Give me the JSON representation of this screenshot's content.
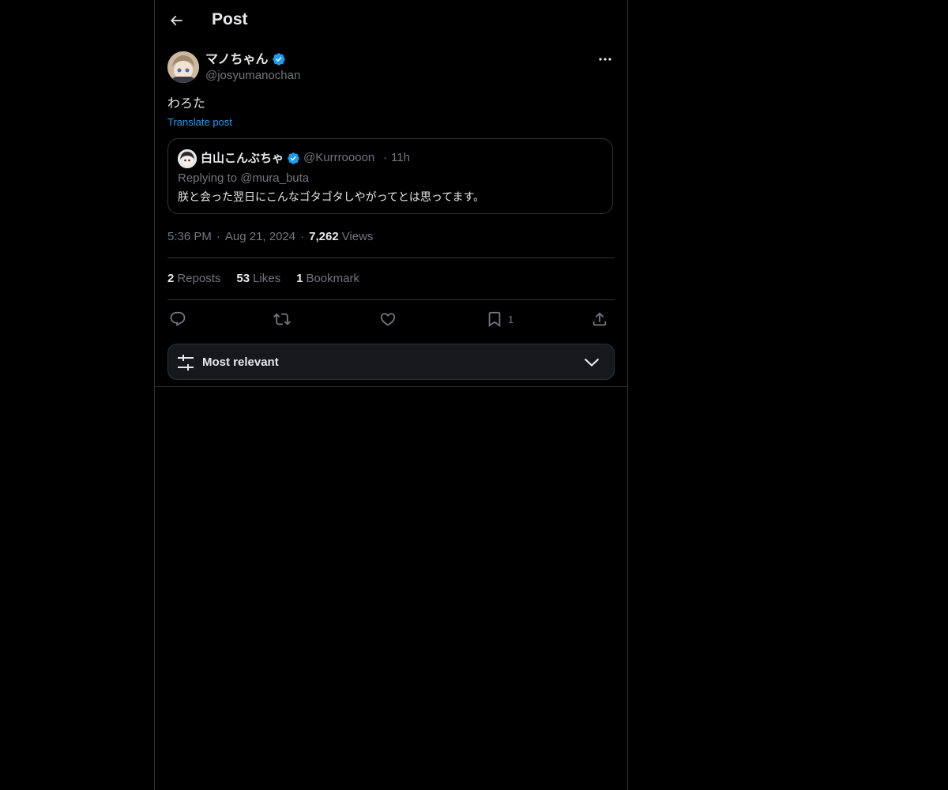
{
  "header": {
    "title": "Post"
  },
  "post": {
    "author_name": "マノちゃん",
    "author_handle": "@josyumanochan",
    "text": "わろた",
    "translate_label": "Translate post",
    "time": "5:36 PM",
    "date": "Aug 21, 2024",
    "views_count": "7,262",
    "views_label": "Views",
    "sep": "·"
  },
  "quote": {
    "author_name": "白山こんぶちゃ",
    "author_handle": "@Kurrroooon",
    "dot": "·",
    "time": "11h",
    "replying": "Replying to @mura_buta",
    "text": "朕と会った翌日にこんなゴタゴタしやがってとは思ってます。"
  },
  "stats": {
    "reposts_count": "2",
    "reposts_label": "Reposts",
    "likes_count": "53",
    "likes_label": "Likes",
    "bookmarks_count": "1",
    "bookmarks_label": "Bookmark"
  },
  "actions": {
    "reply_icon": "reply-icon",
    "repost_icon": "repost-icon",
    "like_icon": "heart-icon",
    "bookmark_icon": "bookmark-icon",
    "bookmark_count": "1",
    "share_icon": "share-icon"
  },
  "sort": {
    "label": "Most relevant"
  },
  "colors": {
    "background": "#000000",
    "text": "#e7e9ea",
    "muted": "#71767b",
    "accent": "#1d9bf0",
    "border": "#2f3336",
    "verified": "#1d9bf0"
  }
}
